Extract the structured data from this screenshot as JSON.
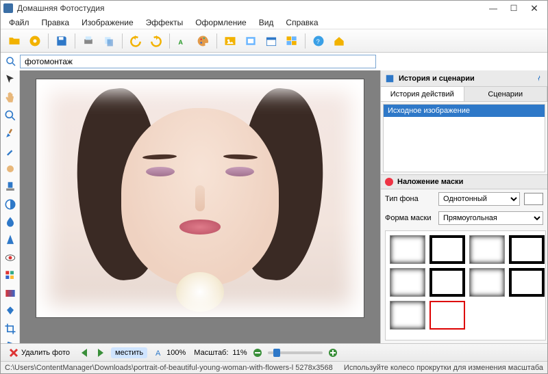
{
  "window": {
    "title": "Домашняя Фотостудия",
    "min": "—",
    "max": "☐",
    "close": "✕"
  },
  "menu": [
    "Файл",
    "Правка",
    "Изображение",
    "Эффекты",
    "Оформление",
    "Вид",
    "Справка"
  ],
  "search": {
    "value": "фотомонтаж"
  },
  "right": {
    "header": "История и сценарии",
    "tab_history": "История действий",
    "tab_scenarios": "Сценарии",
    "history_item": "Исходное изображение",
    "mask_header": "Наложение маски",
    "bg_type_label": "Тип фона",
    "bg_type_value": "Однотонный",
    "shape_label": "Форма маски",
    "shape_value": "Прямоугольная"
  },
  "bottom": {
    "delete_label": "Удалить фото",
    "fit_label": "местить",
    "hundred": "100%",
    "scale_label": "Масштаб:",
    "scale_value": "11%"
  },
  "status": {
    "path": "C:\\Users\\ContentManager\\Downloads\\portrait-of-beautiful-young-woman-with-flowers-l 5278x3568",
    "hint": "Используйте колесо прокрутки для изменения масштаба"
  }
}
